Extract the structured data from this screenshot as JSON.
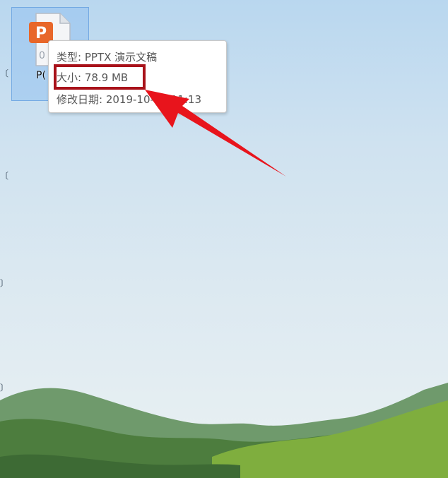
{
  "desktop": {
    "file": {
      "icon": "powerpoint-file-icon",
      "badge_letter": "P",
      "label_partial": "P("
    }
  },
  "tooltip": {
    "type_line": "类型: PPTX 演示文稿",
    "size_line": "大小: 78.9 MB",
    "modified_line": "修改日期: 2019-10-24 11:13"
  },
  "annotation": {
    "highlight_color": "#a8121a",
    "arrow_color": "#e8141c"
  }
}
